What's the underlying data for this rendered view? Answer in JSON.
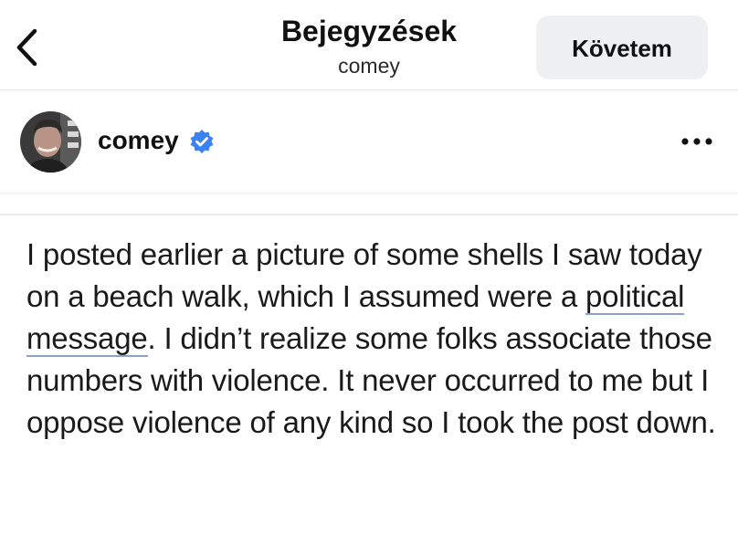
{
  "header": {
    "title": "Bejegyzések",
    "subtitle": "comey",
    "follow_label": "Követem"
  },
  "author": {
    "name": "comey",
    "verified": true
  },
  "post": {
    "text_before_links": "I posted earlier a picture of some shells I saw today on a beach walk, which I assumed were a ",
    "link_word_1": "political",
    "between_links": " ",
    "link_word_2": "message",
    "text_after_links": ". I didn’t realize some folks associate those numbers with violence. It never occurred to me but I oppose violence of any kind so I took the post down."
  },
  "icons": {
    "back": "chevron-left-icon",
    "verified": "verified-badge-icon",
    "more": "more-horizontal-icon"
  },
  "colors": {
    "verified_blue": "#3b82f6",
    "follow_button_bg": "#eff0f2",
    "link_underline": "#8aa0d6"
  }
}
